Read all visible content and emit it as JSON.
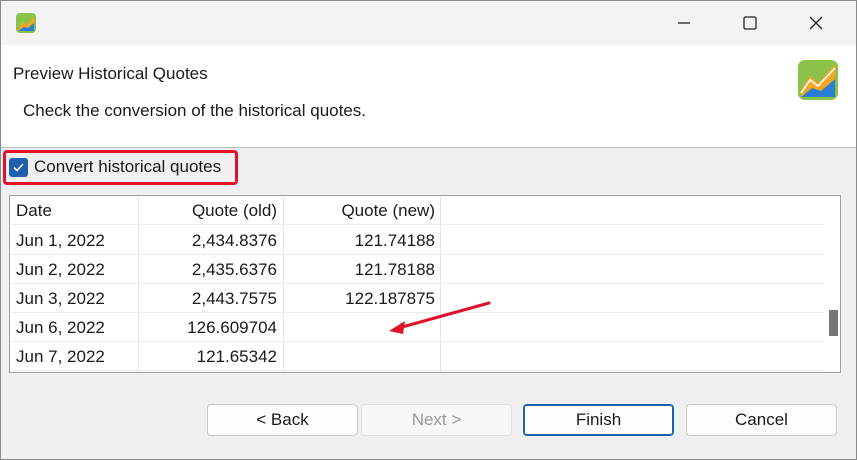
{
  "window": {
    "controls": {
      "minimize_icon": "minimize-icon",
      "maximize_icon": "maximize-icon",
      "close_icon": "close-icon"
    }
  },
  "header": {
    "title": "Preview Historical Quotes",
    "description": "Check the conversion of the historical quotes."
  },
  "options": {
    "convert_label": "Convert historical quotes",
    "convert_checked": true
  },
  "table": {
    "columns": [
      "Date",
      "Quote (old)",
      "Quote (new)"
    ],
    "rows": [
      {
        "date": "Jun 1, 2022",
        "old": "2,434.8376",
        "new": "121.74188"
      },
      {
        "date": "Jun 2, 2022",
        "old": "2,435.6376",
        "new": "121.78188"
      },
      {
        "date": "Jun 3, 2022",
        "old": "2,443.7575",
        "new": "122.187875"
      },
      {
        "date": "Jun 6, 2022",
        "old": "126.609704",
        "new": ""
      },
      {
        "date": "Jun 7, 2022",
        "old": "121.65342",
        "new": ""
      }
    ]
  },
  "buttons": {
    "back": "< Back",
    "next": "Next >",
    "finish": "Finish",
    "cancel": "Cancel"
  },
  "colors": {
    "accent": "#1f5fb0",
    "highlight": "#e0112b"
  }
}
